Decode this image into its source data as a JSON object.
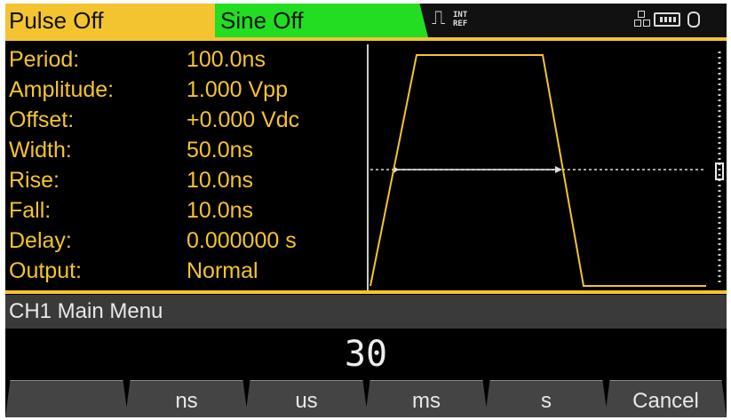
{
  "tabs": [
    {
      "label": "Pulse  Off",
      "color": "#f4c430"
    },
    {
      "label": "Sine  Off",
      "color": "#22dd22"
    }
  ],
  "status": {
    "trigger_line1": "INT",
    "trigger_line2": "REF"
  },
  "parameters": [
    {
      "label": "Period:",
      "value": "100.0ns"
    },
    {
      "label": "Amplitude:",
      "value": "1.000  Vpp"
    },
    {
      "label": "Offset:",
      "value": "+0.000  Vdc"
    },
    {
      "label": "Width:",
      "value": "50.0ns"
    },
    {
      "label": "Rise:",
      "value": "10.0ns"
    },
    {
      "label": "Fall:",
      "value": "10.0ns"
    },
    {
      "label": "Delay:",
      "value": "0.000000  s"
    },
    {
      "label": "Output:",
      "value": "Normal"
    }
  ],
  "menu": {
    "title": "CH1  Main  Menu"
  },
  "entry": {
    "value": "30"
  },
  "softkeys": [
    "",
    "ns",
    "us",
    "ms",
    "s",
    "Cancel"
  ],
  "colors": {
    "accent": "#f4c430",
    "sine_tab": "#22dd22",
    "waveform": "#f4c430"
  }
}
